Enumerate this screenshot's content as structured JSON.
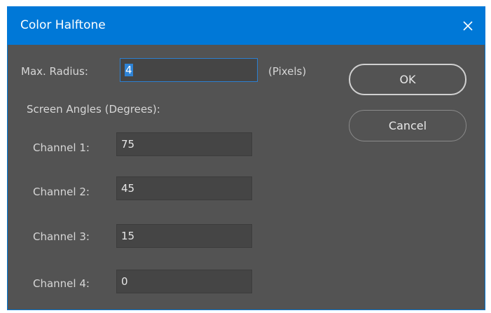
{
  "dialog": {
    "title": "Color Halftone",
    "close_icon": "close-icon",
    "accent_color": "#0078d7",
    "background_color": "#535353"
  },
  "max_radius": {
    "label": "Max. Radius:",
    "value": "4",
    "unit": "(Pixels)"
  },
  "screen_angles": {
    "heading": "Screen Angles (Degrees):",
    "channels": [
      {
        "label": "Channel 1:",
        "value": "75"
      },
      {
        "label": "Channel 2:",
        "value": "45"
      },
      {
        "label": "Channel 3:",
        "value": "15"
      },
      {
        "label": "Channel 4:",
        "value": "0"
      }
    ]
  },
  "buttons": {
    "ok_label": "OK",
    "cancel_label": "Cancel"
  }
}
